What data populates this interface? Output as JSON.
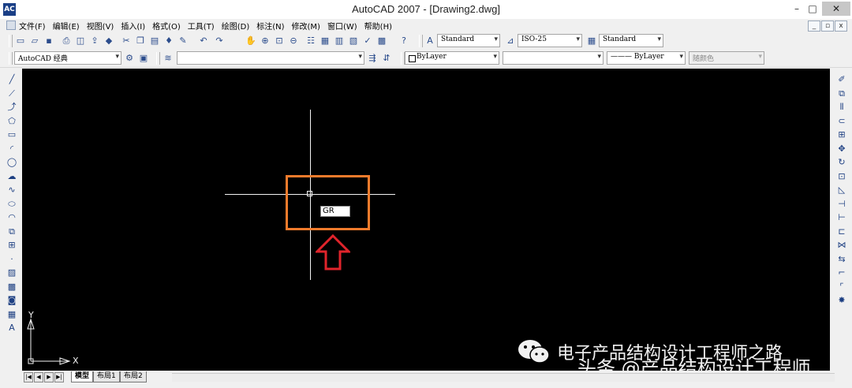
{
  "window": {
    "title": "AutoCAD 2007 - [Drawing2.dwg]",
    "logo": "AC",
    "minimize": "–",
    "maximize": "□",
    "close": "✕"
  },
  "menu": {
    "items": [
      "文件(F)",
      "编辑(E)",
      "视图(V)",
      "插入(I)",
      "格式(O)",
      "工具(T)",
      "绘图(D)",
      "标注(N)",
      "修改(M)",
      "窗口(W)",
      "帮助(H)"
    ],
    "mdi": [
      "_",
      "▫",
      "x"
    ]
  },
  "styles_toolbar": {
    "text_style": "Standard",
    "dim_style": "ISO-25",
    "table_style": "Standard"
  },
  "workspace_toolbar": {
    "workspace": "AutoCAD 经典",
    "layer": "",
    "color": "ByLayer",
    "linetype": "",
    "lineweight": "——— ByLayer",
    "plotstyle": "随颜色"
  },
  "canvas": {
    "command_input": "GR",
    "ucs_y": "Y",
    "ucs_x": "X",
    "colors": {
      "background": "#000000",
      "highlight": "#f37b2c",
      "arrow": "#e0242b"
    }
  },
  "watermark": {
    "line1": "电子产品结构设计工程师之路",
    "line2": "头条 @产品结构设计工程师"
  },
  "layout_tabs": {
    "nav": [
      "|◀",
      "◀",
      "▶",
      "▶|"
    ],
    "tabs": [
      "模型",
      "布局1",
      "布局2"
    ]
  },
  "icons": {
    "top_row1": [
      "new-icon",
      "open-icon",
      "save-icon",
      "print-icon",
      "preview-icon",
      "publish-icon",
      "3d-icon",
      "cut-icon",
      "copy-icon",
      "paste-icon",
      "match-icon",
      "brush-icon",
      "undo-icon",
      "redo-icon",
      "pan-icon",
      "zoom-realtime-icon",
      "zoom-window-icon",
      "zoom-previous-icon",
      "properties-icon",
      "designcenter-icon",
      "toolpalette-icon",
      "sheetset-icon",
      "markup-icon",
      "calc-icon",
      "help-icon"
    ],
    "left": [
      "line-icon",
      "construction-line-icon",
      "polyline-icon",
      "polygon-icon",
      "rectangle-icon",
      "arc-icon",
      "circle-icon",
      "revcloud-icon",
      "spline-icon",
      "ellipse-icon",
      "ellipse-arc-icon",
      "insert-block-icon",
      "make-block-icon",
      "point-icon",
      "hatch-icon",
      "gradient-icon",
      "region-icon",
      "table-icon",
      "mtext-icon"
    ],
    "right": [
      "erase-icon",
      "copy-object-icon",
      "mirror-icon",
      "offset-icon",
      "array-icon",
      "move-icon",
      "rotate-icon",
      "scale-icon",
      "stretch-icon",
      "trim-icon",
      "extend-icon",
      "break-point-icon",
      "break-icon",
      "join-icon",
      "chamfer-icon",
      "fillet-icon",
      "explode-icon"
    ]
  }
}
